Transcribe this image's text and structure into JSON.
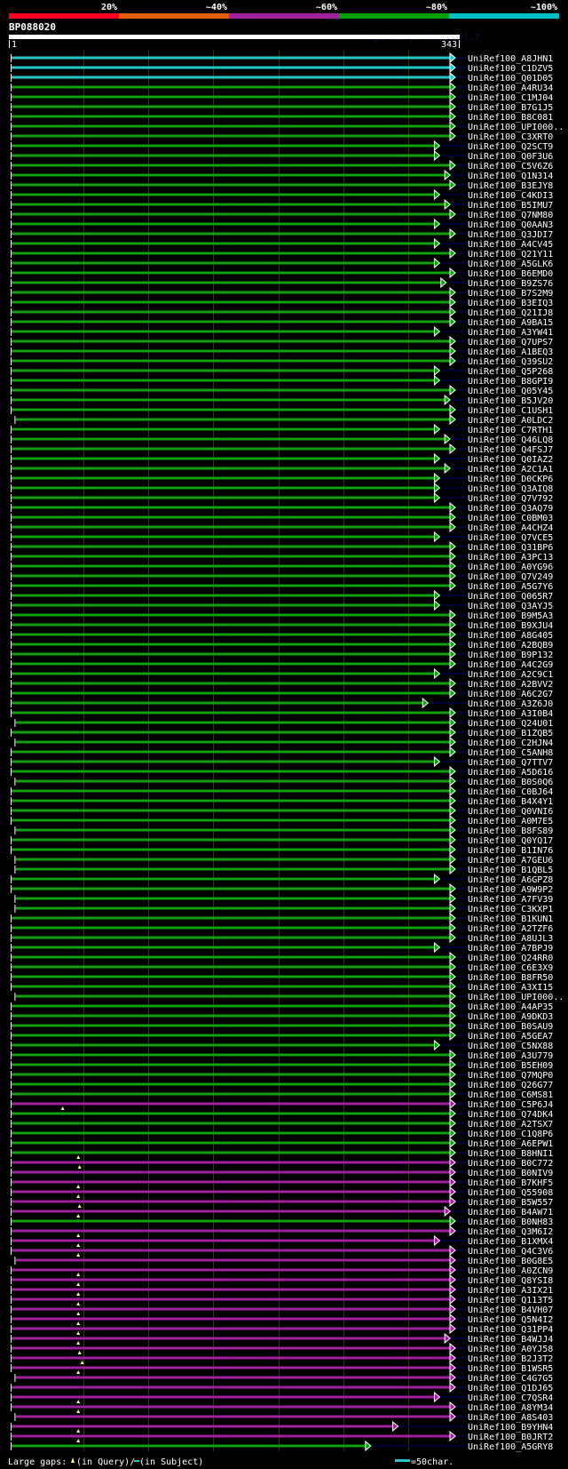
{
  "legend": {
    "labels": [
      "20%",
      "~40%",
      "~60%",
      "~80%",
      "~100%"
    ],
    "colors": [
      "#ff0020",
      "#e06000",
      "#a020a0",
      "#00a000",
      "#00c0c8"
    ]
  },
  "query": {
    "name": "BP088020",
    "start": "1",
    "end": "343",
    "length": 343
  },
  "watermark": "AlignView.pm Beta rel.7",
  "palette": {
    "c": "#20c8c8",
    "g": "#10a010",
    "m": "#a020a0",
    "gap_marker": "#ffff80",
    "subject_tail": "#000038",
    "grid": "#33331a"
  },
  "grid_every": 50,
  "rows": [
    {
      "id": "UniRef100_A8JHN1",
      "color": "c",
      "end": 343
    },
    {
      "id": "UniRef100_C1DZV5",
      "color": "c",
      "end": 343
    },
    {
      "id": "UniRef100_Q01D05",
      "color": "c",
      "end": 343
    },
    {
      "id": "UniRef100_A4RU34",
      "color": "g",
      "end": 343
    },
    {
      "id": "UniRef100_C1MJ04",
      "color": "g",
      "end": 343
    },
    {
      "id": "UniRef100_B7G1J5",
      "color": "g",
      "end": 343
    },
    {
      "id": "UniRef100_B8C081",
      "color": "g",
      "end": 343
    },
    {
      "id": "UniRef100_UPI000..",
      "color": "g",
      "end": 343
    },
    {
      "id": "UniRef100_C3XRT0",
      "color": "g",
      "end": 343
    },
    {
      "id": "UniRef100_Q2SCT9",
      "color": "g",
      "end": 331
    },
    {
      "id": "UniRef100_Q0F3U6",
      "color": "g",
      "end": 331
    },
    {
      "id": "UniRef100_C5V6Z6",
      "color": "g",
      "end": 343
    },
    {
      "id": "UniRef100_Q1N314",
      "color": "g",
      "end": 339
    },
    {
      "id": "UniRef100_B3EJY8",
      "color": "g",
      "end": 343
    },
    {
      "id": "UniRef100_C4KDI3",
      "color": "g",
      "end": 331
    },
    {
      "id": "UniRef100_B5IMU7",
      "color": "g",
      "end": 339
    },
    {
      "id": "UniRef100_Q7NM80",
      "color": "g",
      "end": 343
    },
    {
      "id": "UniRef100_Q0AAN3",
      "color": "g",
      "end": 331
    },
    {
      "id": "UniRef100_Q3JDI7",
      "color": "g",
      "end": 343
    },
    {
      "id": "UniRef100_A4CV45",
      "color": "g",
      "end": 331
    },
    {
      "id": "UniRef100_Q21Y11",
      "color": "g",
      "end": 343
    },
    {
      "id": "UniRef100_A5GLK6",
      "color": "g",
      "end": 331
    },
    {
      "id": "UniRef100_B6EMD0",
      "color": "g",
      "end": 343
    },
    {
      "id": "UniRef100_B9ZS76",
      "color": "g",
      "end": 336
    },
    {
      "id": "UniRef100_B7S2M9",
      "color": "g",
      "end": 343
    },
    {
      "id": "UniRef100_B3EIQ3",
      "color": "g",
      "end": 343
    },
    {
      "id": "UniRef100_Q21IJ8",
      "color": "g",
      "end": 343
    },
    {
      "id": "UniRef100_A9BA15",
      "color": "g",
      "end": 343
    },
    {
      "id": "UniRef100_A3YW41",
      "color": "g",
      "end": 331
    },
    {
      "id": "UniRef100_Q7UPS7",
      "color": "g",
      "end": 343
    },
    {
      "id": "UniRef100_A1BEQ3",
      "color": "g",
      "end": 343
    },
    {
      "id": "UniRef100_Q39SU2",
      "color": "g",
      "end": 343
    },
    {
      "id": "UniRef100_Q5P268",
      "color": "g",
      "end": 331
    },
    {
      "id": "UniRef100_B8GPI9",
      "color": "g",
      "end": 331
    },
    {
      "id": "UniRef100_Q05Y45",
      "color": "g",
      "end": 343
    },
    {
      "id": "UniRef100_B5JV20",
      "color": "g",
      "end": 339
    },
    {
      "id": "UniRef100_C1USH1",
      "color": "g",
      "end": 343
    },
    {
      "id": "UniRef100_A0LDC2",
      "color": "g",
      "end": 343,
      "start": 4
    },
    {
      "id": "UniRef100_C7RTH1",
      "color": "g",
      "end": 331
    },
    {
      "id": "UniRef100_Q46LQ8",
      "color": "g",
      "end": 339
    },
    {
      "id": "UniRef100_Q4FSJ7",
      "color": "g",
      "end": 343
    },
    {
      "id": "UniRef100_Q0IAZ2",
      "color": "g",
      "end": 331
    },
    {
      "id": "UniRef100_A2C1A1",
      "color": "g",
      "end": 339
    },
    {
      "id": "UniRef100_D0CKP6",
      "color": "g",
      "end": 331
    },
    {
      "id": "UniRef100_Q3AIQ8",
      "color": "g",
      "end": 331
    },
    {
      "id": "UniRef100_Q7V792",
      "color": "g",
      "end": 331
    },
    {
      "id": "UniRef100_Q3AQ79",
      "color": "g",
      "end": 343
    },
    {
      "id": "UniRef100_C0BM03",
      "color": "g",
      "end": 343
    },
    {
      "id": "UniRef100_A4CHZ4",
      "color": "g",
      "end": 343
    },
    {
      "id": "UniRef100_Q7VCE5",
      "color": "g",
      "end": 331
    },
    {
      "id": "UniRef100_Q31BP6",
      "color": "g",
      "end": 343
    },
    {
      "id": "UniRef100_A3PC13",
      "color": "g",
      "end": 343
    },
    {
      "id": "UniRef100_A0YG96",
      "color": "g",
      "end": 343
    },
    {
      "id": "UniRef100_Q7V249",
      "color": "g",
      "end": 343
    },
    {
      "id": "UniRef100_A5G7Y6",
      "color": "g",
      "end": 343
    },
    {
      "id": "UniRef100_Q065R7",
      "color": "g",
      "end": 331
    },
    {
      "id": "UniRef100_Q3AYJ5",
      "color": "g",
      "end": 331
    },
    {
      "id": "UniRef100_B9M5A3",
      "color": "g",
      "end": 343
    },
    {
      "id": "UniRef100_B9XJU4",
      "color": "g",
      "end": 343
    },
    {
      "id": "UniRef100_A8G405",
      "color": "g",
      "end": 343
    },
    {
      "id": "UniRef100_A2BQB9",
      "color": "g",
      "end": 343
    },
    {
      "id": "UniRef100_B9P132",
      "color": "g",
      "end": 343
    },
    {
      "id": "UniRef100_A4C2G9",
      "color": "g",
      "end": 343
    },
    {
      "id": "UniRef100_A2C9C1",
      "color": "g",
      "end": 331
    },
    {
      "id": "UniRef100_A2BVV2",
      "color": "g",
      "end": 343
    },
    {
      "id": "UniRef100_A6C2G7",
      "color": "g",
      "end": 343
    },
    {
      "id": "UniRef100_A3Z6J0",
      "color": "g",
      "end": 322
    },
    {
      "id": "UniRef100_A3I0B4",
      "color": "g",
      "end": 343
    },
    {
      "id": "UniRef100_Q24U01",
      "color": "g",
      "end": 343,
      "start": 4
    },
    {
      "id": "UniRef100_B1ZQB5",
      "color": "g",
      "end": 343
    },
    {
      "id": "UniRef100_C2HJN4",
      "color": "g",
      "end": 343,
      "start": 4
    },
    {
      "id": "UniRef100_C5ANH8",
      "color": "g",
      "end": 343
    },
    {
      "id": "UniRef100_Q7TTV7",
      "color": "g",
      "end": 331
    },
    {
      "id": "UniRef100_A5D616",
      "color": "g",
      "end": 343
    },
    {
      "id": "UniRef100_B0S0Q6",
      "color": "g",
      "end": 343,
      "start": 4
    },
    {
      "id": "UniRef100_C0BJ64",
      "color": "g",
      "end": 343
    },
    {
      "id": "UniRef100_B4X4Y1",
      "color": "g",
      "end": 343
    },
    {
      "id": "UniRef100_Q0VNI6",
      "color": "g",
      "end": 343
    },
    {
      "id": "UniRef100_A0M7E5",
      "color": "g",
      "end": 343
    },
    {
      "id": "UniRef100_B8FS89",
      "color": "g",
      "end": 343,
      "start": 4
    },
    {
      "id": "UniRef100_Q0YQ17",
      "color": "g",
      "end": 343
    },
    {
      "id": "UniRef100_B1IN76",
      "color": "g",
      "end": 343
    },
    {
      "id": "UniRef100_A7GEU6",
      "color": "g",
      "end": 343,
      "start": 4
    },
    {
      "id": "UniRef100_B1QBL5",
      "color": "g",
      "end": 343,
      "start": 4
    },
    {
      "id": "UniRef100_A6GPZ8",
      "color": "g",
      "end": 331
    },
    {
      "id": "UniRef100_A9W9P2",
      "color": "g",
      "end": 343
    },
    {
      "id": "UniRef100_A7FV39",
      "color": "g",
      "end": 343,
      "start": 4
    },
    {
      "id": "UniRef100_C3KXP1",
      "color": "g",
      "end": 343,
      "start": 4
    },
    {
      "id": "UniRef100_B1KUN1",
      "color": "g",
      "end": 343
    },
    {
      "id": "UniRef100_A2TZF6",
      "color": "g",
      "end": 343
    },
    {
      "id": "UniRef100_A8UJL3",
      "color": "g",
      "end": 343
    },
    {
      "id": "UniRef100_A7BPJ9",
      "color": "g",
      "end": 331
    },
    {
      "id": "UniRef100_Q24RR0",
      "color": "g",
      "end": 343
    },
    {
      "id": "UniRef100_C6E3X9",
      "color": "g",
      "end": 343
    },
    {
      "id": "UniRef100_B8FR50",
      "color": "g",
      "end": 343
    },
    {
      "id": "UniRef100_A3XI15",
      "color": "g",
      "end": 343
    },
    {
      "id": "UniRef100_UPI000..",
      "color": "g",
      "end": 343,
      "start": 4
    },
    {
      "id": "UniRef100_A4AP35",
      "color": "g",
      "end": 343
    },
    {
      "id": "UniRef100_A9DKD3",
      "color": "g",
      "end": 343
    },
    {
      "id": "UniRef100_B0SAU9",
      "color": "g",
      "end": 343
    },
    {
      "id": "UniRef100_A5GEA7",
      "color": "g",
      "end": 343
    },
    {
      "id": "UniRef100_C5NX88",
      "color": "g",
      "end": 331
    },
    {
      "id": "UniRef100_A3U779",
      "color": "g",
      "end": 343
    },
    {
      "id": "UniRef100_B5EH09",
      "color": "g",
      "end": 343
    },
    {
      "id": "UniRef100_Q7MQP0",
      "color": "g",
      "end": 343
    },
    {
      "id": "UniRef100_Q26G77",
      "color": "g",
      "end": 343
    },
    {
      "id": "UniRef100_C6MS81",
      "color": "g",
      "end": 343
    },
    {
      "id": "UniRef100_C5P6J4",
      "color": "m",
      "end": 343,
      "gap": 41
    },
    {
      "id": "UniRef100_Q74DK4",
      "color": "g",
      "end": 343
    },
    {
      "id": "UniRef100_A2TSX7",
      "color": "g",
      "end": 343
    },
    {
      "id": "UniRef100_C1Q8P6",
      "color": "g",
      "end": 343
    },
    {
      "id": "UniRef100_A6EPW1",
      "color": "g",
      "end": 343
    },
    {
      "id": "UniRef100_B8HNI1",
      "color": "g",
      "end": 343,
      "gap": 53
    },
    {
      "id": "UniRef100_B0C772",
      "color": "m",
      "end": 343,
      "gap": 54
    },
    {
      "id": "UniRef100_B0NIV9",
      "color": "m",
      "end": 343
    },
    {
      "id": "UniRef100_B7KHF5",
      "color": "m",
      "end": 343,
      "gap": 53
    },
    {
      "id": "UniRef100_Q55908",
      "color": "m",
      "end": 343,
      "gap": 53
    },
    {
      "id": "UniRef100_B5W557",
      "color": "m",
      "end": 343,
      "gap": 54
    },
    {
      "id": "UniRef100_B4AW71",
      "color": "m",
      "end": 339,
      "gap": 53
    },
    {
      "id": "UniRef100_B0NH83",
      "color": "g",
      "end": 343
    },
    {
      "id": "UniRef100_Q3M6I2",
      "color": "m",
      "end": 343,
      "gap": 53
    },
    {
      "id": "UniRef100_B1XMX4",
      "color": "m",
      "end": 331,
      "gap": 53
    },
    {
      "id": "UniRef100_Q4C3V6",
      "color": "m",
      "end": 343,
      "gap": 53
    },
    {
      "id": "UniRef100_B0G8E5",
      "color": "m",
      "end": 343,
      "start": 4
    },
    {
      "id": "UniRef100_A0ZCN9",
      "color": "m",
      "end": 343,
      "gap": 53
    },
    {
      "id": "UniRef100_Q8YSI8",
      "color": "m",
      "end": 343,
      "gap": 53
    },
    {
      "id": "UniRef100_A3IX21",
      "color": "m",
      "end": 343,
      "gap": 53
    },
    {
      "id": "UniRef100_Q113T5",
      "color": "m",
      "end": 343,
      "gap": 53
    },
    {
      "id": "UniRef100_B4VH07",
      "color": "m",
      "end": 343,
      "gap": 53
    },
    {
      "id": "UniRef100_Q5N4I2",
      "color": "m",
      "end": 343,
      "gap": 53
    },
    {
      "id": "UniRef100_Q31PP4",
      "color": "m",
      "end": 343,
      "gap": 53
    },
    {
      "id": "UniRef100_B4WJJ4",
      "color": "m",
      "end": 339,
      "gap": 53
    },
    {
      "id": "UniRef100_A0YJ58",
      "color": "m",
      "end": 343,
      "gap": 54
    },
    {
      "id": "UniRef100_B2J3T2",
      "color": "m",
      "end": 343,
      "gap": 56
    },
    {
      "id": "UniRef100_B1WSR5",
      "color": "m",
      "end": 343,
      "gap": 53
    },
    {
      "id": "UniRef100_C4G7G5",
      "color": "m",
      "end": 343,
      "start": 4
    },
    {
      "id": "UniRef100_Q1DJ65",
      "color": "m",
      "end": 343
    },
    {
      "id": "UniRef100_C7QSR4",
      "color": "m",
      "end": 331,
      "gap": 53
    },
    {
      "id": "UniRef100_A8YM34",
      "color": "m",
      "end": 343,
      "gap": 53
    },
    {
      "id": "UniRef100_A8S403",
      "color": "m",
      "end": 343,
      "start": 4
    },
    {
      "id": "UniRef100_B9YHN4",
      "color": "m",
      "end": 299,
      "gap": 53
    },
    {
      "id": "UniRef100_B0JRT2",
      "color": "m",
      "end": 343,
      "gap": 53
    },
    {
      "id": "UniRef100_A5GRY8",
      "color": "g",
      "end": 278
    }
  ],
  "footer": {
    "large_gaps_label": "Large gaps:",
    "in_query": "(in Query)/",
    "subject_dash": "-",
    "in_subject": " (in Subject)",
    "scale_label": "=50char."
  }
}
